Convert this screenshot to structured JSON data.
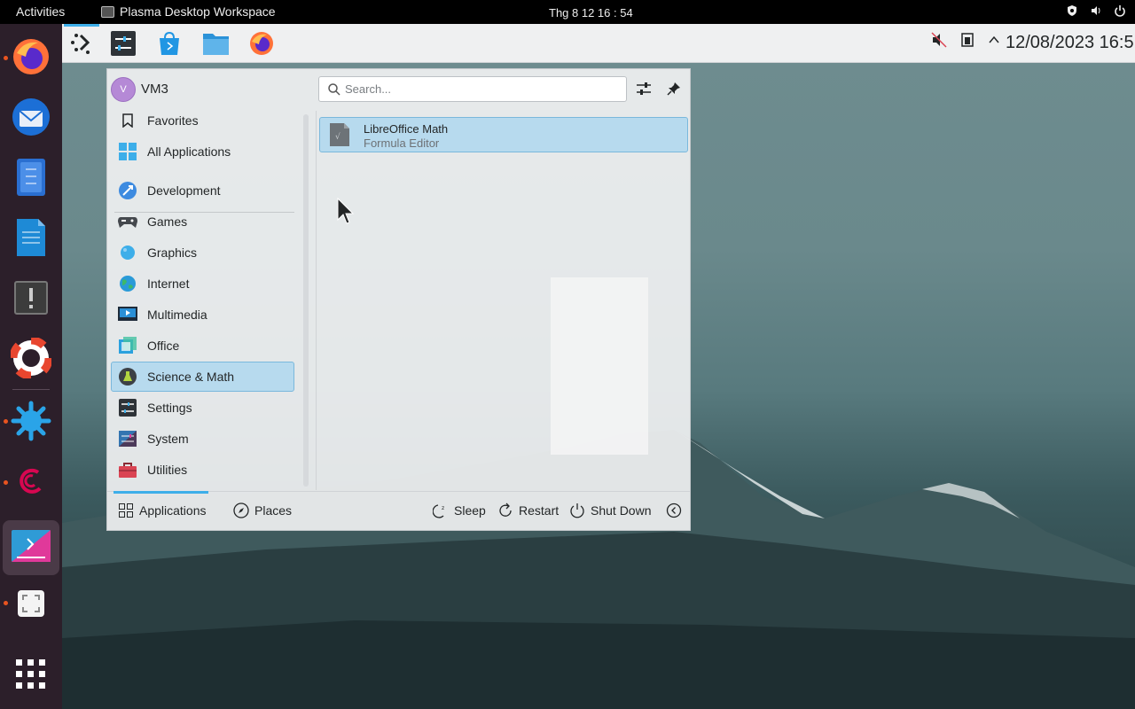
{
  "gnome_topbar": {
    "activities": "Activities",
    "app_name": "Plasma Desktop Workspace",
    "clock": "Thg 8 12  16 : 54"
  },
  "dock": {
    "items": [
      "firefox",
      "thunderbird",
      "text-editor",
      "libreoffice-writer",
      "software-updater",
      "help",
      "kde-connect",
      "debian",
      "plasma-desktop-workspace",
      "screenshot",
      "show-applications"
    ]
  },
  "kde_panel": {
    "launchers": [
      "application-launcher",
      "system-settings",
      "discover",
      "dolphin",
      "firefox"
    ],
    "datetime": "12/08/2023 16:5"
  },
  "kickoff": {
    "user": {
      "initial": "V",
      "name": "VM3"
    },
    "search": {
      "placeholder": "Search..."
    },
    "categories": [
      {
        "label": "Favorites"
      },
      {
        "label": "All Applications"
      },
      {
        "label": "Development"
      },
      {
        "label": "Games"
      },
      {
        "label": "Graphics"
      },
      {
        "label": "Internet"
      },
      {
        "label": "Multimedia"
      },
      {
        "label": "Office"
      },
      {
        "label": "Science & Math"
      },
      {
        "label": "Settings"
      },
      {
        "label": "System"
      },
      {
        "label": "Utilities"
      }
    ],
    "selected_category": "Science & Math",
    "apps": [
      {
        "name": "LibreOffice Math",
        "description": "Formula Editor"
      }
    ],
    "footer": {
      "applications": "Applications",
      "places": "Places",
      "sleep": "Sleep",
      "restart": "Restart",
      "shutdown": "Shut Down"
    }
  },
  "colors": {
    "accent": "#3daee9",
    "selection": "#b7daee",
    "dock_bg": "#2c1f2a",
    "ubuntu_orange": "#e95420"
  }
}
